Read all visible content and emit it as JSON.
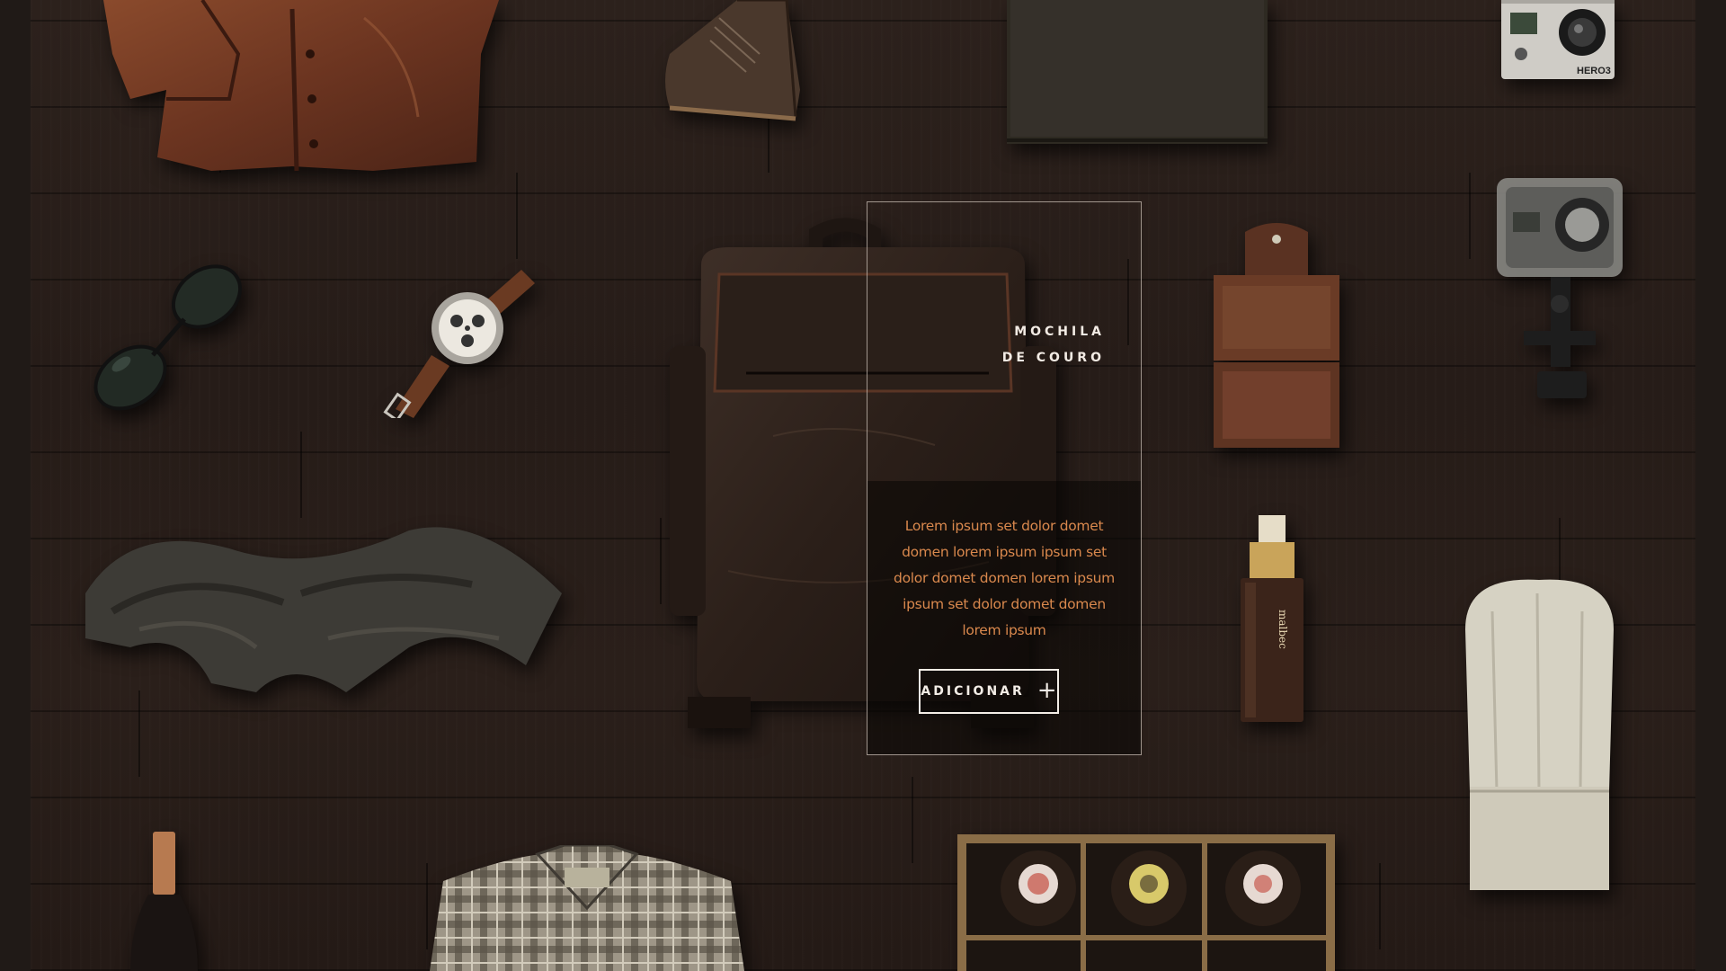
{
  "products": [
    {
      "name": "jaqueta-de-couro"
    },
    {
      "name": "bota"
    },
    {
      "name": "caderno"
    },
    {
      "name": "camera-gopro"
    },
    {
      "name": "oculos-de-sol"
    },
    {
      "name": "relogio"
    },
    {
      "name": "mochila-de-couro"
    },
    {
      "name": "carteira"
    },
    {
      "name": "gopro-caixa-estanque"
    },
    {
      "name": "cachecol"
    },
    {
      "name": "perfume"
    },
    {
      "name": "chapeu-de-chef"
    },
    {
      "name": "vinho"
    },
    {
      "name": "camisa-xadrez"
    },
    {
      "name": "caixa-de-cervejas"
    }
  ],
  "camera": {
    "model_label": "HERO3"
  },
  "perfume": {
    "label": "malbec"
  },
  "featured": {
    "title_line1": "MOCHILA",
    "title_line2": "DE COURO",
    "description": "Lorem ipsum set dolor domet domen lorem ipsum ipsum set dolor domet domen lorem ipsum ipsum set dolor domet domen lorem ipsum",
    "add_label": "ADICIONAR",
    "add_icon": "plus-icon"
  },
  "colors": {
    "background": "#261c18",
    "accent": "#d9884d",
    "panel_border": "#c8beb4",
    "button_text": "#f3ede6"
  }
}
